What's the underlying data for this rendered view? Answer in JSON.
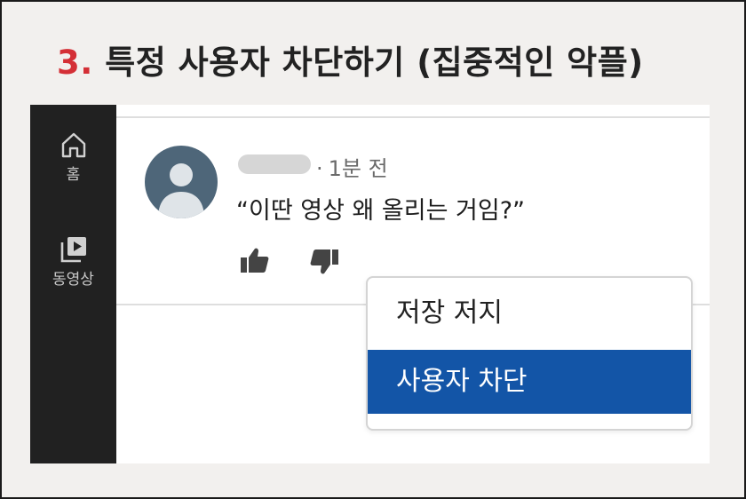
{
  "header": {
    "step_number": "3.",
    "title": "특정 사용자 차단하기 (집중적인 악플)"
  },
  "sidebar": {
    "items": [
      {
        "label": "홈",
        "icon": "home-icon"
      },
      {
        "label": "동영상",
        "icon": "video-library-icon"
      }
    ]
  },
  "comment": {
    "time": "1분 전",
    "text": "“이딴 영상 왜 올리는 거임?”",
    "like_icon": "thumbs-up-icon",
    "dislike_icon": "thumbs-down-icon"
  },
  "context_menu": {
    "items": [
      {
        "label": "저장 저지"
      },
      {
        "label": "사용자 차단"
      }
    ]
  },
  "colors": {
    "title_number": "#d42f36",
    "sidebar_bg": "#212121",
    "avatar_bg": "#4e6679",
    "menu_highlight": "#1355a7"
  }
}
